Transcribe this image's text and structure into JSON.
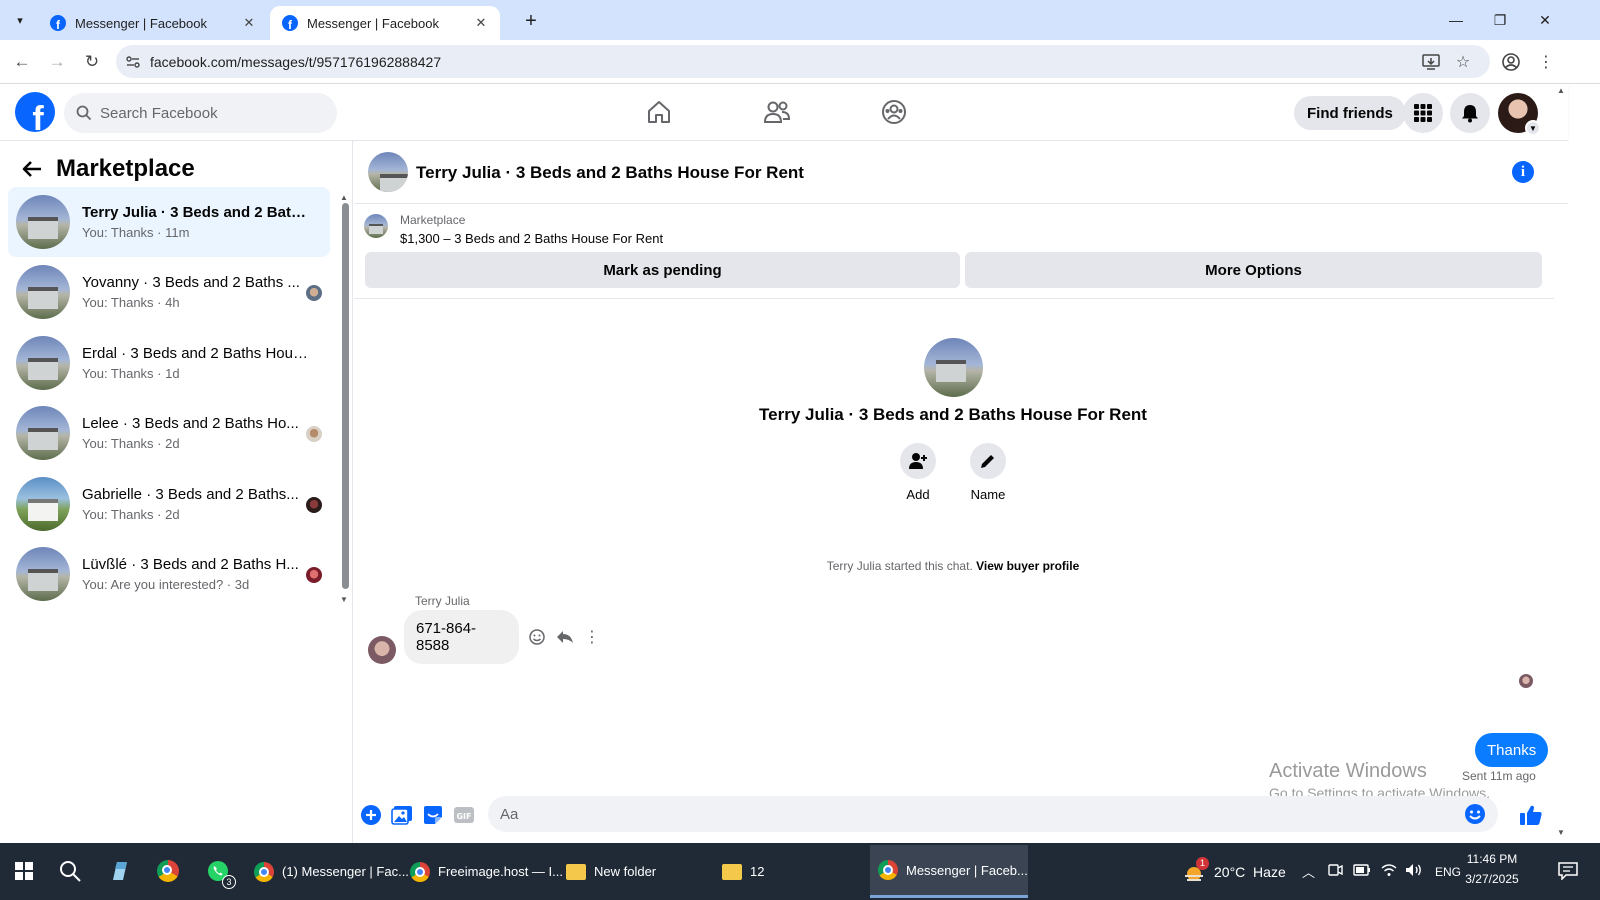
{
  "browser": {
    "tabs": [
      {
        "title": "Messenger | Facebook",
        "active": false
      },
      {
        "title": "Messenger | Facebook",
        "active": true
      }
    ],
    "url": "facebook.com/messages/t/9571761962888427"
  },
  "fb_header": {
    "search_placeholder": "Search Facebook",
    "nav": [
      "home-icon",
      "friends-icon",
      "groups-icon"
    ],
    "find_friends": "Find friends",
    "colors": {
      "brand": "#0866ff",
      "accent_bubble": "#0a7cff"
    }
  },
  "sidebar": {
    "title": "Marketplace",
    "conversations": [
      {
        "name": "Terry Julia · 3 Beds and 2 Baths ...",
        "preview": "You: Thanks · 11m",
        "selected": true
      },
      {
        "name": "Yovanny · 3 Beds and 2 Baths ...",
        "preview": "You: Thanks · 4h",
        "selected": false
      },
      {
        "name": "Erdal · 3 Beds and 2 Baths Hous...",
        "preview": "You: Thanks · 1d",
        "selected": false
      },
      {
        "name": "Lelee · 3 Beds and 2 Baths Ho...",
        "preview": "You: Thanks · 2d",
        "selected": false
      },
      {
        "name": "Gabrielle · 3 Beds and 2 Baths...",
        "preview": "You: Thanks · 2d",
        "selected": false
      },
      {
        "name": "Lüvßlé · 3 Beds and 2 Baths H...",
        "preview": "You: Are you interested? · 3d",
        "selected": false
      }
    ]
  },
  "chat": {
    "title": "Terry Julia · 3 Beds and 2 Baths House For Rent",
    "listing": {
      "source": "Marketplace",
      "price_title": "$1,300 – 3 Beds and 2 Baths House For Rent",
      "mark_pending": "Mark as pending",
      "more_options": "More Options"
    },
    "intro": {
      "name": "Terry Julia · 3 Beds and 2 Baths House For Rent",
      "add_label": "Add",
      "name_label": "Name",
      "started_text": "Terry Julia started this chat.",
      "view_profile": "View buyer profile"
    },
    "messages": [
      {
        "sender": "Terry Julia",
        "text": "671-864-8588",
        "direction": "in"
      },
      {
        "sender": "You",
        "text": "Thanks",
        "direction": "out",
        "status": "Sent 11m ago"
      }
    ],
    "composer_placeholder": "Aa"
  },
  "watermark": {
    "line1": "Activate Windows",
    "line2": "Go to Settings to activate Windows."
  },
  "taskbar": {
    "apps": [
      {
        "label": "(1) Messenger | Fac...",
        "active": false
      },
      {
        "label": "Freeimage.host — I...",
        "active": false
      },
      {
        "label": "New folder",
        "active": false
      },
      {
        "label": "12",
        "active": false
      },
      {
        "label": "Messenger | Faceb...",
        "active": true
      }
    ],
    "whatsapp_badge": "3",
    "weather": "20°C  Haze",
    "weather_badge": "1",
    "language": "ENG",
    "time": "11:46 PM",
    "date": "3/27/2025"
  }
}
